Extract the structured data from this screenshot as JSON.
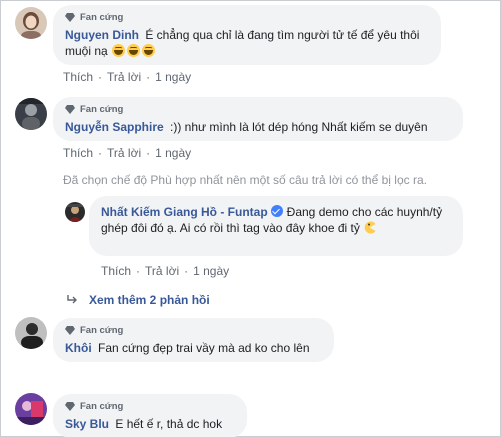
{
  "badge_label": "Fan cứng",
  "comments": [
    {
      "name": "Nguyen Dinh",
      "text": "É chẳng qua chỉ là đang tìm người tử tế để yêu thôi muội nạ",
      "actions": {
        "like": "Thích",
        "reply": "Trả lời",
        "time": "1 ngày"
      }
    },
    {
      "name": "Nguyễn Sapphire",
      "text": ":)) như mình là lót dép hóng Nhất kiếm se duyên",
      "actions": {
        "like": "Thích",
        "reply": "Trả lời",
        "time": "1 ngày"
      }
    },
    {
      "name": "Khôi",
      "text": "Fan cứng đẹp trai vầy mà ad ko cho lên"
    },
    {
      "name": "Sky Blu",
      "text": "E hết ế r, thả dc hok"
    }
  ],
  "filter_notice": "Đã chọn chế độ Phù hợp nhất nên một số câu trả lời có thể bị lọc ra.",
  "reply": {
    "name": "Nhất Kiếm Giang Hồ - Funtap",
    "text": "Đang demo cho các huynh/tỷ ghép đôi đó ạ. Ai có rồi thì tag vào đây khoe đi tỷ",
    "actions": {
      "like": "Thích",
      "reply": "Trả lời",
      "time": "1 ngày"
    }
  },
  "see_more": "Xem thêm 2 phản hồi",
  "colors": {
    "name": "#385898",
    "bubble": "#f2f3f5",
    "meta": "#606770"
  }
}
